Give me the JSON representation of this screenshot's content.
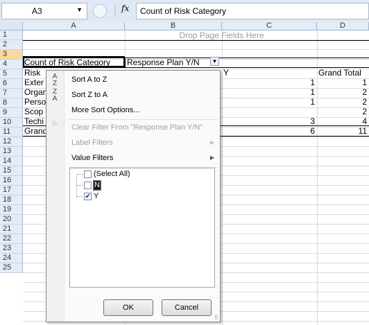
{
  "formula_bar": {
    "name_box": "A3",
    "fx": "fx",
    "formula": "Count of Risk Category"
  },
  "columns": [
    "A",
    "B",
    "C",
    "D"
  ],
  "rows": [
    "1",
    "2",
    "3",
    "4",
    "5",
    "6",
    "7",
    "8",
    "9",
    "10",
    "11",
    "12",
    "13",
    "14",
    "15",
    "16",
    "17",
    "18",
    "19",
    "20",
    "21",
    "22",
    "23",
    "24",
    "25"
  ],
  "sheet": {
    "drop_page_fields": "Drop Page Fields Here",
    "a3": "Count of Risk Category",
    "b3": "Response Plan Y/N",
    "a4": "Risk",
    "c4": "Y",
    "d4": "Grand Total",
    "a_rows": [
      "Exter",
      "Organ",
      "Perso",
      "Scop",
      "Techi",
      "Grand"
    ],
    "c_values": [
      "1",
      "1",
      "1",
      "",
      "3",
      "6"
    ],
    "d_values": [
      "1",
      "2",
      "2",
      "2",
      "4",
      "11"
    ]
  },
  "menu": {
    "sort_az": "Sort A to Z",
    "sort_za": "Sort Z to A",
    "more_sort": "More Sort Options...",
    "clear_filter": "Clear Filter From \"Response Plan Y/N\"",
    "label_filters": "Label Filters",
    "value_filters": "Value Filters",
    "items": [
      {
        "label": "(Select All)",
        "check": ""
      },
      {
        "label": "N",
        "check": ""
      },
      {
        "label": "Y",
        "check": "✔"
      }
    ],
    "ok": "OK",
    "cancel": "Cancel"
  }
}
